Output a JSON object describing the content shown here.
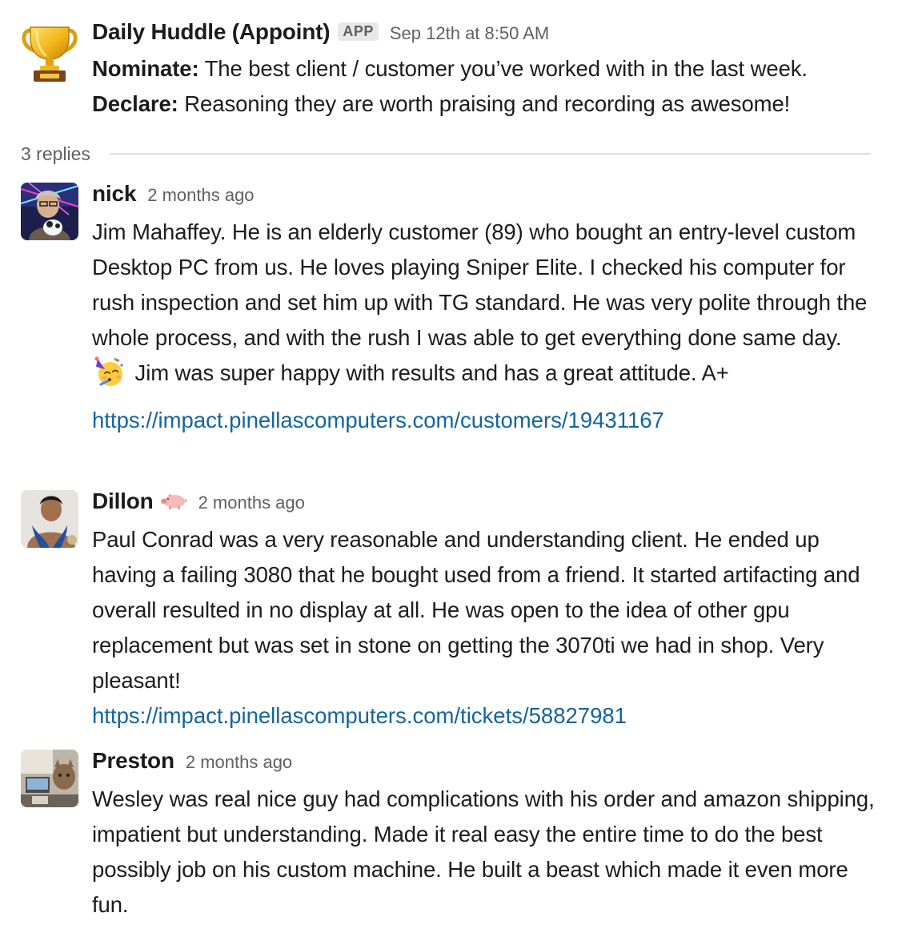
{
  "thread": {
    "parent": {
      "sender": "Daily Huddle (Appoint)",
      "badge": "APP",
      "timestamp": "Sep 12th at 8:50 AM",
      "avatar_icon": "trophy-icon",
      "lines": [
        {
          "label": "Nominate:",
          "text": " The best client / customer you’ve worked with in the last week."
        },
        {
          "label": "Declare:",
          "text": " Reasoning they are worth praising and recording as awesome!"
        }
      ]
    },
    "replies_count": "3 replies",
    "replies": [
      {
        "sender": "nick",
        "timestamp": "2 months ago",
        "text_before_emoji": "Jim Mahaffey. He is an elderly customer (89) who bought an entry-level custom Desktop PC from us. He loves playing Sniper Elite. I checked his computer for rush inspection and set him up with TG standard. He was very polite through the whole process, and with the rush I was able to get everything done same day.",
        "emoji": "partying-face-icon",
        "text_after_emoji": " Jim was super happy with results and has a great attitude. A+",
        "link": "https://impact.pinellascomputers.com/customers/19431167"
      },
      {
        "sender": "Dillon",
        "status_emoji": "pig-icon",
        "timestamp": "2 months ago",
        "text": "Paul Conrad was a very reasonable and understanding client. He ended up having a failing 3080 that he bought used from a friend. It started artifacting and overall resulted in no display at all. He was open to the idea of other gpu replacement but was set in stone on getting the 3070ti we had in shop. Very pleasant!",
        "link": "https://impact.pinellascomputers.com/tickets/58827981"
      },
      {
        "sender": "Preston",
        "timestamp": "2 months ago",
        "text": "Wesley was real nice guy had complications with his order and amazon shipping, impatient but understanding. Made it real easy the entire time to do the best possibly job on his custom machine. He built a beast which made it even more fun."
      }
    ]
  },
  "colors": {
    "text": "#1d1c1d",
    "muted": "#616061",
    "link": "#1264a3",
    "divider": "#dddddd"
  }
}
